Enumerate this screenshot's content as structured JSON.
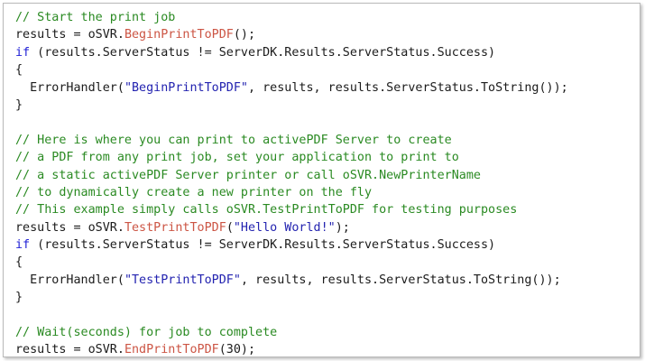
{
  "colors": {
    "comment": "#2a8a22",
    "keyword": "#2323d6",
    "method": "#cc5544",
    "string": "#2323b0",
    "plain": "#1b1b1b"
  },
  "code_lines": [
    {
      "id": "line-1",
      "tokens": [
        {
          "type": "comment",
          "text": "// Start the print job"
        }
      ]
    },
    {
      "id": "line-2",
      "tokens": [
        {
          "type": "plain",
          "text": "results = oSVR."
        },
        {
          "type": "method",
          "text": "BeginPrintToPDF"
        },
        {
          "type": "plain",
          "text": "();"
        }
      ]
    },
    {
      "id": "line-3",
      "tokens": [
        {
          "type": "keyword",
          "text": "if"
        },
        {
          "type": "plain",
          "text": " (results.ServerStatus != ServerDK.Results.ServerStatus.Success)"
        }
      ]
    },
    {
      "id": "line-4",
      "tokens": [
        {
          "type": "plain",
          "text": "{"
        }
      ]
    },
    {
      "id": "line-5",
      "tokens": [
        {
          "type": "plain",
          "text": "  ErrorHandler("
        },
        {
          "type": "string",
          "text": "\"BeginPrintToPDF\""
        },
        {
          "type": "plain",
          "text": ", results, results.ServerStatus.ToString());"
        }
      ]
    },
    {
      "id": "line-6",
      "tokens": [
        {
          "type": "plain",
          "text": "}"
        }
      ]
    },
    {
      "id": "line-7",
      "tokens": []
    },
    {
      "id": "line-8",
      "tokens": [
        {
          "type": "comment",
          "text": "// Here is where you can print to activePDF Server to create"
        }
      ]
    },
    {
      "id": "line-9",
      "tokens": [
        {
          "type": "comment",
          "text": "// a PDF from any print job, set your application to print to"
        }
      ]
    },
    {
      "id": "line-10",
      "tokens": [
        {
          "type": "comment",
          "text": "// a static activePDF Server printer or call oSVR.NewPrinterName"
        }
      ]
    },
    {
      "id": "line-11",
      "tokens": [
        {
          "type": "comment",
          "text": "// to dynamically create a new printer on the fly"
        }
      ]
    },
    {
      "id": "line-12",
      "tokens": [
        {
          "type": "comment",
          "text": "// This example simply calls oSVR.TestPrintToPDF for testing purposes"
        }
      ]
    },
    {
      "id": "line-13",
      "tokens": [
        {
          "type": "plain",
          "text": "results = oSVR."
        },
        {
          "type": "method",
          "text": "TestPrintToPDF"
        },
        {
          "type": "plain",
          "text": "("
        },
        {
          "type": "string",
          "text": "\"Hello World!\""
        },
        {
          "type": "plain",
          "text": ");"
        }
      ]
    },
    {
      "id": "line-14",
      "tokens": [
        {
          "type": "keyword",
          "text": "if"
        },
        {
          "type": "plain",
          "text": " (results.ServerStatus != ServerDK.Results.ServerStatus.Success)"
        }
      ]
    },
    {
      "id": "line-15",
      "tokens": [
        {
          "type": "plain",
          "text": "{"
        }
      ]
    },
    {
      "id": "line-16",
      "tokens": [
        {
          "type": "plain",
          "text": "  ErrorHandler("
        },
        {
          "type": "string",
          "text": "\"TestPrintToPDF\""
        },
        {
          "type": "plain",
          "text": ", results, results.ServerStatus.ToString());"
        }
      ]
    },
    {
      "id": "line-17",
      "tokens": [
        {
          "type": "plain",
          "text": "}"
        }
      ]
    },
    {
      "id": "line-18",
      "tokens": []
    },
    {
      "id": "line-19",
      "tokens": [
        {
          "type": "comment",
          "text": "// Wait(seconds) for job to complete"
        }
      ]
    },
    {
      "id": "line-20",
      "tokens": [
        {
          "type": "plain",
          "text": "results = oSVR."
        },
        {
          "type": "method",
          "text": "EndPrintToPDF"
        },
        {
          "type": "plain",
          "text": "(30);"
        }
      ]
    }
  ]
}
